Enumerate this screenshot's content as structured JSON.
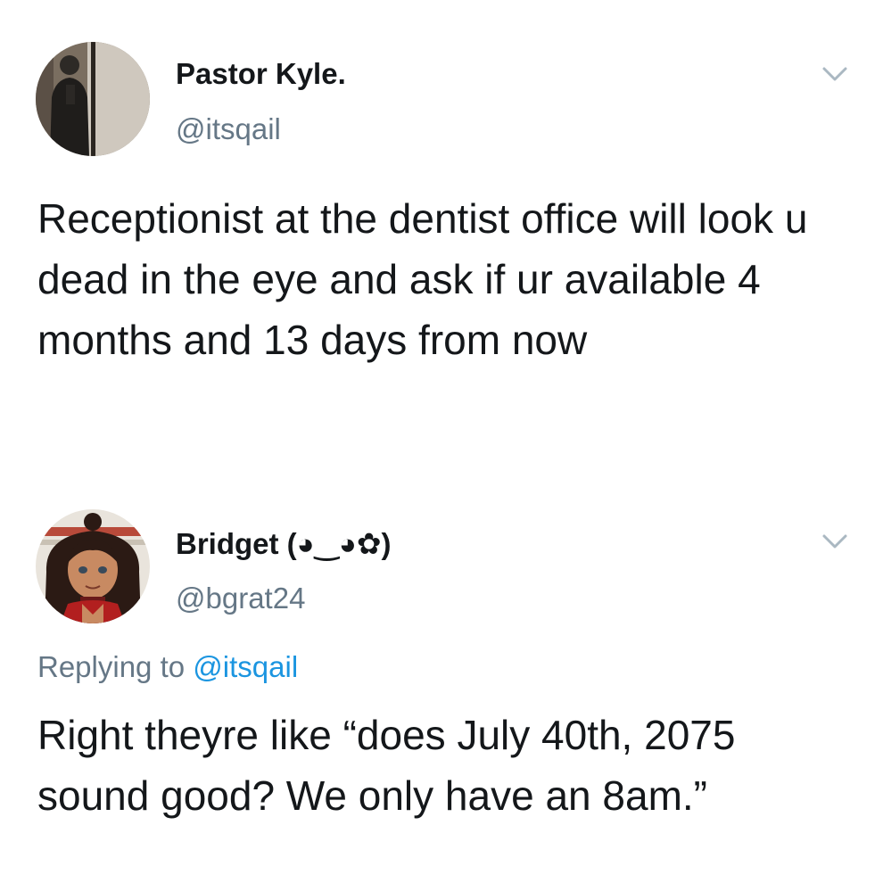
{
  "tweets": [
    {
      "display_name": "Pastor Kyle.",
      "handle": "@itsqail",
      "text": "Receptionist at the dentist office will look u dead in the eye and ask if ur available 4 months and 13 days from now",
      "avatar_icon": "user-avatar-photo",
      "menu_icon": "chevron-down-icon"
    },
    {
      "display_name": "Bridget (◕‿◕✿)",
      "handle": "@bgrat24",
      "reply_prefix": "Replying to",
      "reply_to": "@itsqail",
      "text": "Right theyre like “does July 40th, 2075 sound good? We only have an 8am.”",
      "avatar_icon": "cartoon-avatar",
      "menu_icon": "chevron-down-icon"
    }
  ],
  "colors": {
    "text_primary": "#14171a",
    "text_secondary": "#657786",
    "link": "#1b95e0",
    "chevron": "#aab8c2"
  }
}
